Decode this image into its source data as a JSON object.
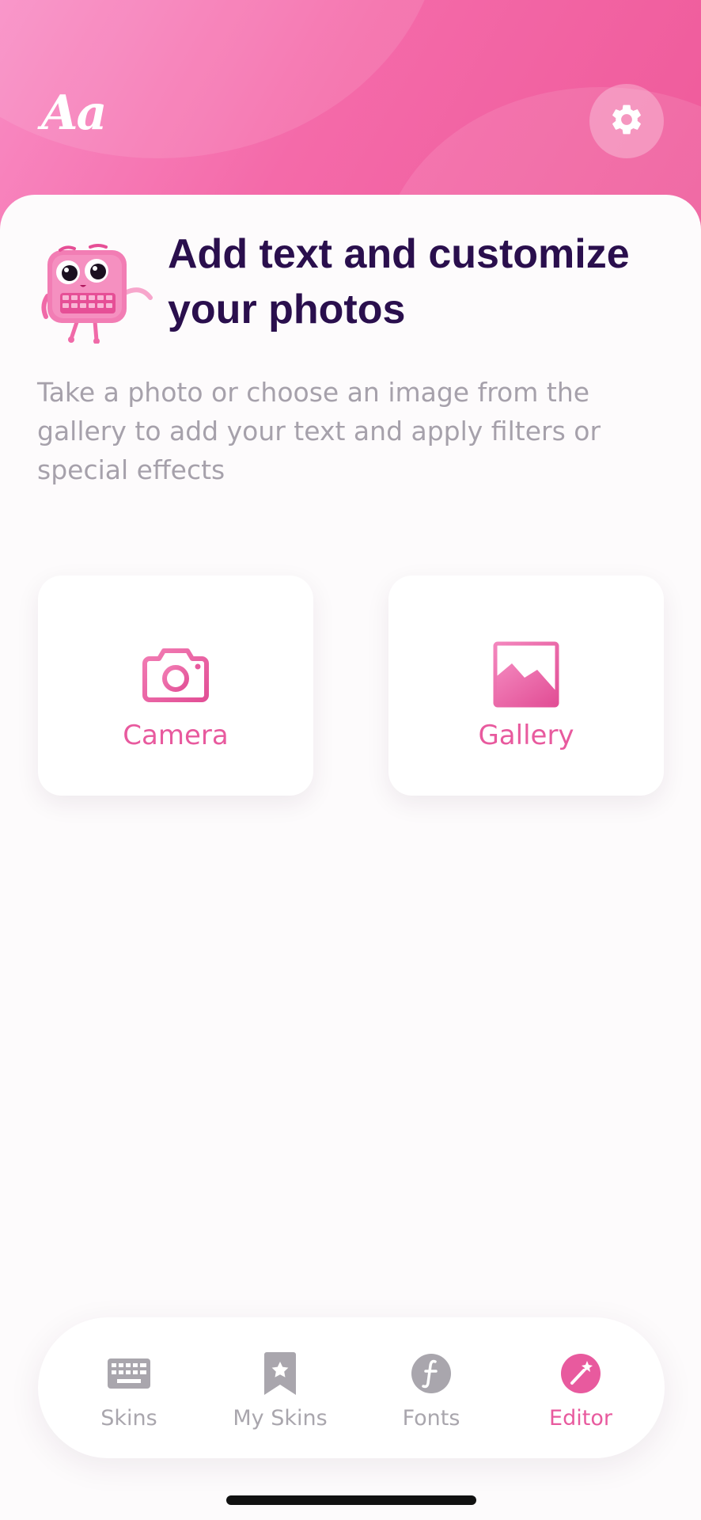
{
  "header": {
    "logo_text": "Aa",
    "settings_icon": "gear-icon"
  },
  "intro": {
    "title": "Add text and customize your photos",
    "description": "Take a photo or choose an image from the gallery to add your text and apply filters or special effects"
  },
  "actions": [
    {
      "label": "Camera",
      "icon": "camera-icon"
    },
    {
      "label": "Gallery",
      "icon": "image-icon"
    }
  ],
  "tabbar": {
    "items": [
      {
        "label": "Skins",
        "icon": "keyboard-icon",
        "active": false
      },
      {
        "label": "My Skins",
        "icon": "bookmark-star-icon",
        "active": false
      },
      {
        "label": "Fonts",
        "icon": "font-icon",
        "active": false
      },
      {
        "label": "Editor",
        "icon": "magic-wand-icon",
        "active": true
      }
    ]
  },
  "colors": {
    "accent": "#e85a9e",
    "header_gradient_start": "#f98cc4",
    "header_gradient_end": "#ef5a9a",
    "title_text": "#2a0f4d",
    "muted_text": "#a6a1ab",
    "inactive_tab": "#a9a6ad"
  }
}
